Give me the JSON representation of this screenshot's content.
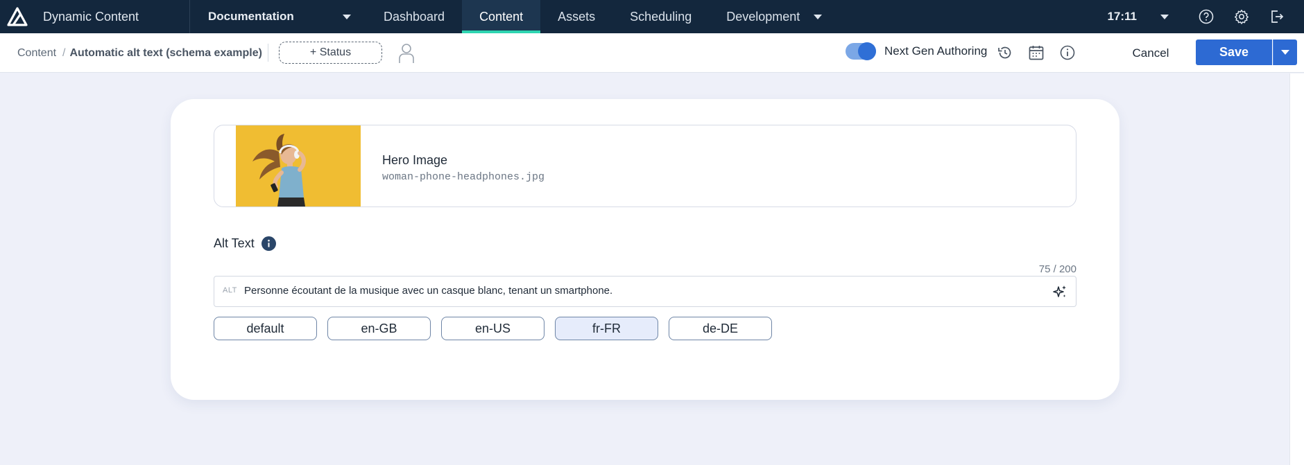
{
  "topbar": {
    "app_name": "Dynamic Content",
    "hub": "Documentation",
    "tabs": [
      {
        "label": "Dashboard",
        "active": false
      },
      {
        "label": "Content",
        "active": true
      },
      {
        "label": "Assets",
        "active": false
      },
      {
        "label": "Scheduling",
        "active": false
      },
      {
        "label": "Development",
        "active": false
      }
    ],
    "clock": "17:11",
    "icons": [
      "help-icon",
      "settings-icon",
      "logout-icon"
    ]
  },
  "subbar": {
    "breadcrumb_root": "Content",
    "breadcrumb_sep": "/",
    "breadcrumb_current": "Automatic alt text (schema example)",
    "status_button": "+ Status",
    "toggle_label": "Next Gen Authoring",
    "toggle_on": true,
    "cancel": "Cancel",
    "save": "Save"
  },
  "content": {
    "image_title": "Hero Image",
    "image_file": "woman-phone-headphones.jpg",
    "alt_label": "Alt Text",
    "char_count": "75 / 200",
    "alt_prefix": "ALT",
    "alt_value": "Personne écoutant de la musique avec un casque blanc, tenant un smartphone.",
    "locales": [
      {
        "label": "default",
        "selected": false
      },
      {
        "label": "en-GB",
        "selected": false
      },
      {
        "label": "en-US",
        "selected": false
      },
      {
        "label": "fr-FR",
        "selected": true
      },
      {
        "label": "de-DE",
        "selected": false
      }
    ]
  },
  "colors": {
    "topbar_bg": "#13273d",
    "accent_tab": "#2fd5b1",
    "primary_button": "#2d6ad3",
    "page_bg": "#eef0f9",
    "thumbnail_bg": "#efb92c"
  }
}
